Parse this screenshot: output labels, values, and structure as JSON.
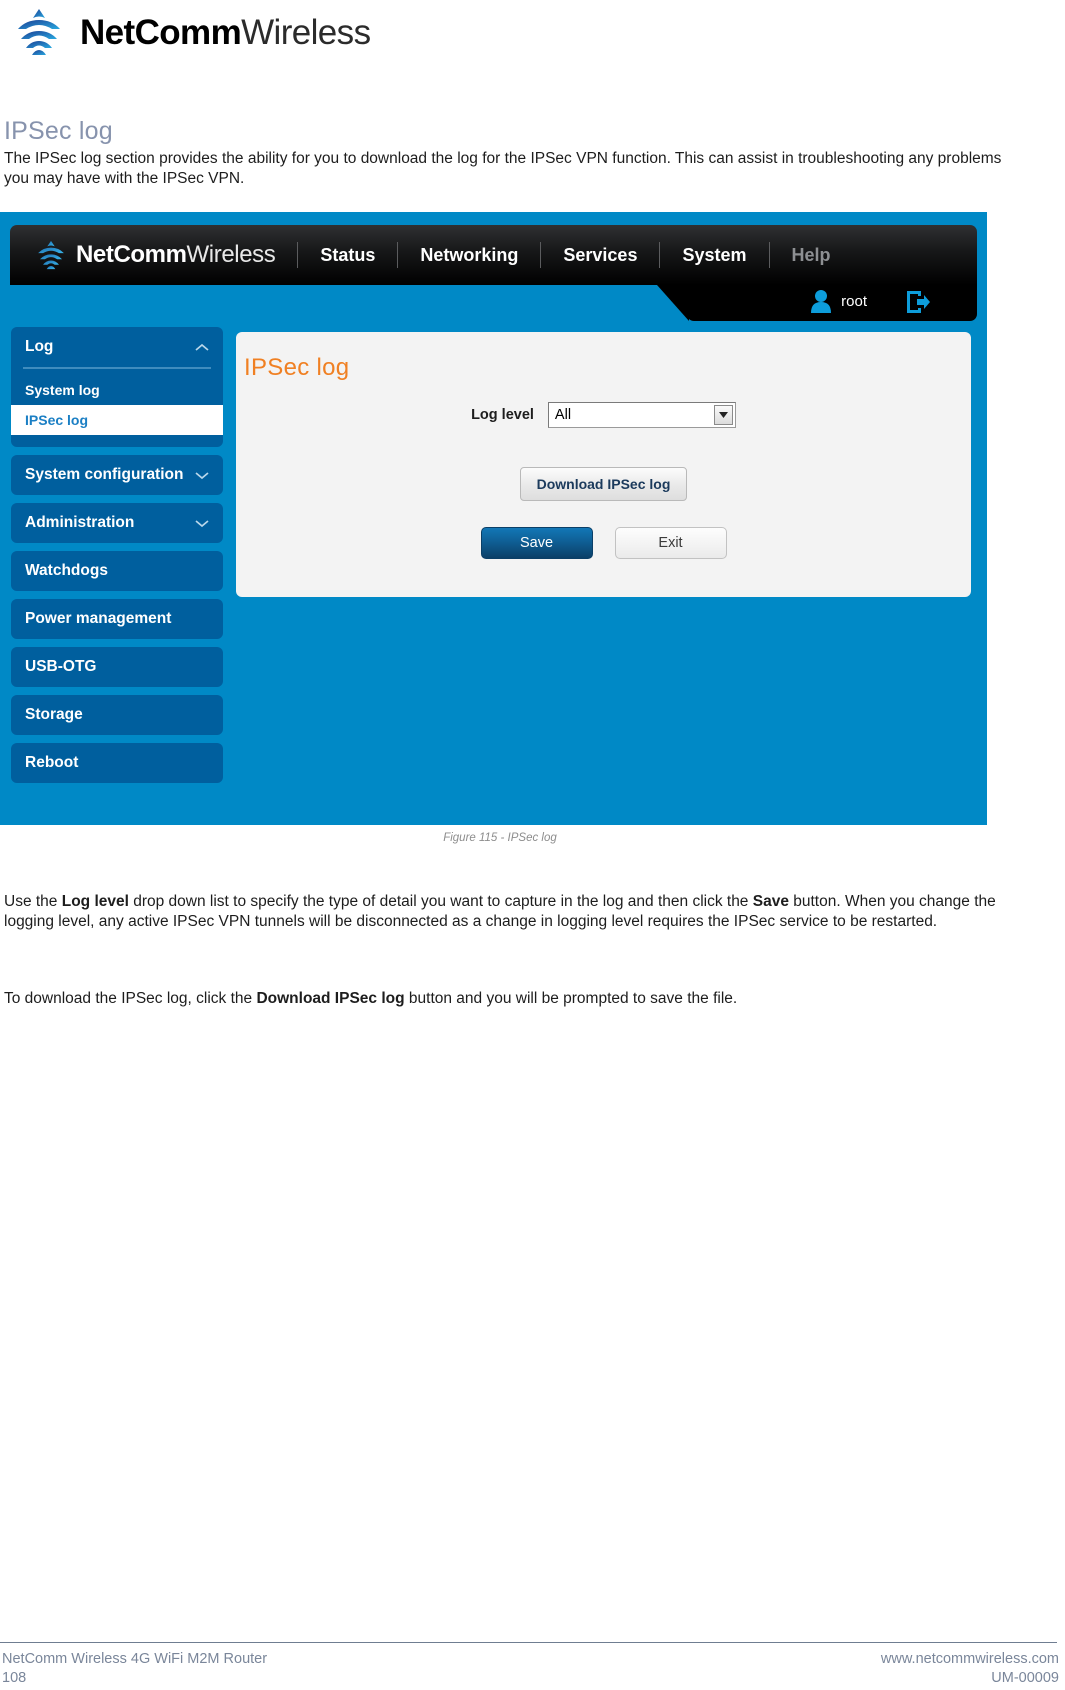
{
  "brand": {
    "name_bold": "NetComm",
    "name_light": "Wireless",
    "logo_icon": "wifi-arcs-icon"
  },
  "document": {
    "heading": "IPSec log",
    "intro_paragraph": "The IPSec log section provides the ability for you to download the log for the IPSec VPN function. This can assist in troubleshooting any problems you may have with the IPSec VPN.",
    "figure_caption": "Figure 115 - IPSec log",
    "use_paragraph_1": "Use the ",
    "use_bold_1": "Log level",
    "use_paragraph_2": " drop down list to specify the type of detail you want to capture in the log and then click the ",
    "use_bold_2": "Save",
    "use_paragraph_3": " button. When you change the logging level, any active IPSec VPN tunnels will be disconnected as a change in logging level requires the IPSec service to be restarted.",
    "download_paragraph_1": "To download the IPSec log, click the ",
    "download_bold_1": "Download IPSec log",
    "download_paragraph_2": " button and you will be prompted to save the file."
  },
  "router_ui": {
    "nav": {
      "brand_bold": "NetComm",
      "brand_light": "Wireless",
      "items": [
        {
          "label": "Status",
          "dim": false
        },
        {
          "label": "Networking",
          "dim": false
        },
        {
          "label": "Services",
          "dim": false
        },
        {
          "label": "System",
          "dim": false
        },
        {
          "label": "Help",
          "dim": true
        }
      ],
      "user_name": "root",
      "user_icon": "person-icon",
      "logout_icon": "logout-arrow-icon"
    },
    "sidebar": {
      "groups": [
        {
          "label": "Log",
          "expanded": true,
          "chevron": "chevron-up-icon",
          "sub_items": [
            {
              "label": "System log",
              "active": false
            },
            {
              "label": "IPSec log",
              "active": true
            }
          ]
        },
        {
          "label": "System configuration",
          "expanded": false,
          "chevron": "chevron-down-icon",
          "sub_items": []
        },
        {
          "label": "Administration",
          "expanded": false,
          "chevron": "chevron-down-icon",
          "sub_items": []
        },
        {
          "label": "Watchdogs",
          "expanded": false,
          "chevron": "",
          "sub_items": []
        },
        {
          "label": "Power management",
          "expanded": false,
          "chevron": "",
          "sub_items": []
        },
        {
          "label": "USB-OTG",
          "expanded": false,
          "chevron": "",
          "sub_items": []
        },
        {
          "label": "Storage",
          "expanded": false,
          "chevron": "",
          "sub_items": []
        },
        {
          "label": "Reboot",
          "expanded": false,
          "chevron": "",
          "sub_items": []
        }
      ]
    },
    "panel": {
      "title": "IPSec log",
      "log_level_label": "Log level",
      "log_level_value": "All",
      "download_button": "Download IPSec log",
      "save_button": "Save",
      "exit_button": "Exit"
    },
    "colors": {
      "page_blue": "#0089c6",
      "sidebar_blue": "#005f9e",
      "panel_title_orange": "#f08023",
      "accent_link_blue": "#1b7fc4"
    }
  },
  "footer": {
    "left_line1": "NetComm Wireless 4G WiFi M2M Router",
    "left_line2": "108",
    "right_line1": "www.netcommwireless.com",
    "right_line2": "UM-00009"
  }
}
